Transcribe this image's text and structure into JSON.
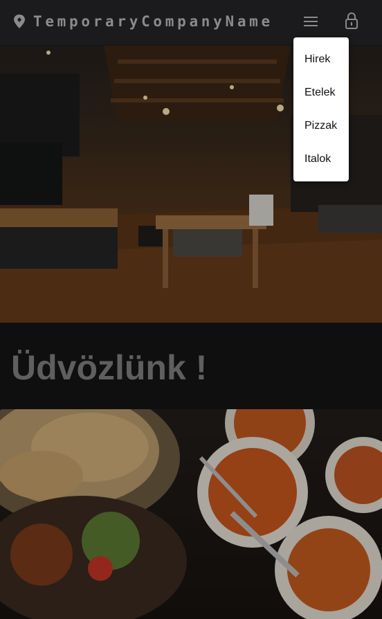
{
  "navbar": {
    "brand": "TemporaryCompanyName",
    "brand_icon": "map-pin-icon",
    "menu_icon": "menu-icon",
    "login_icon": "lock-icon"
  },
  "menu": {
    "items": [
      {
        "label": "Hirek"
      },
      {
        "label": "Etelek"
      },
      {
        "label": "Pizzak"
      },
      {
        "label": "Italok"
      }
    ]
  },
  "hero": {
    "image": "restaurant-interior-photo"
  },
  "welcome": {
    "title": "Üdvözlünk !"
  },
  "food": {
    "image": "food-dishes-photo"
  },
  "colors": {
    "navbar_bg": "#1b1b1d",
    "page_bg": "#0f0f0f",
    "brand_text": "#8b8b8e",
    "welcome_text": "#5f5f60",
    "dropdown_bg": "#ffffff"
  }
}
